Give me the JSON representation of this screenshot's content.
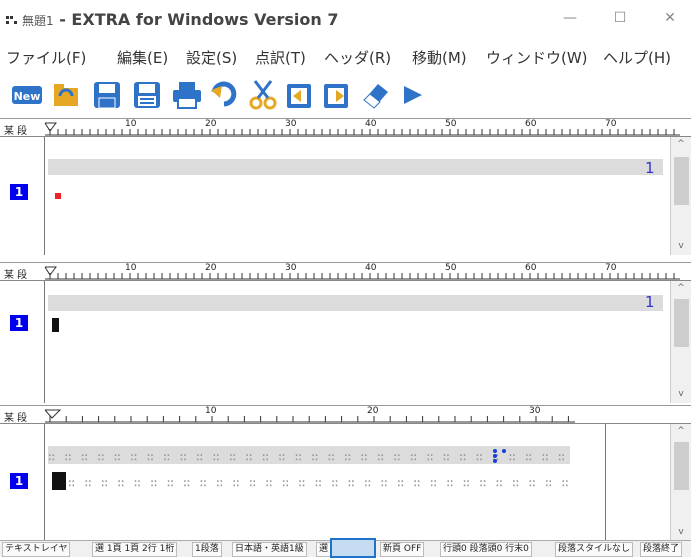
{
  "window": {
    "title_prefix": "無題1",
    "title_app": " - EXTRA for Windows Version 7",
    "minimize": "—",
    "maximize": "☐",
    "close": "✕"
  },
  "menu": [
    {
      "label": "ファイル(F)"
    },
    {
      "label": "編集(E)"
    },
    {
      "label": "設定(S)"
    },
    {
      "label": "点訳(T)"
    },
    {
      "label": "ヘッダ(R)"
    },
    {
      "label": "移動(M)"
    },
    {
      "label": "ウィンドウ(W)"
    },
    {
      "label": "ヘルプ(H)"
    }
  ],
  "toolbar": {
    "new_label": "New"
  },
  "ruler": {
    "label": "某 段",
    "ticks_top": [
      "10",
      "20",
      "30",
      "40",
      "50",
      "60",
      "70"
    ],
    "ticks_bottom": [
      "10",
      "20",
      "30"
    ]
  },
  "panes": [
    {
      "line_number": "1",
      "row_count": "1"
    },
    {
      "line_number": "1",
      "row_count": "1"
    },
    {
      "line_number": "1"
    }
  ],
  "braille": {
    "row1": "∷ ∷ ∷ ∷ ∷ ∷ ∷ ∷ ∷ ∷ ∷ ∷ ∷ ∷ ∷ ∷ ∷ ∷ ∷ ∷ ∷ ∷ ∷ ∷ ∷ ∷ ∷ ∷ ∷ ∷ ∷ ∷ ∷ ∷ ∷ ∷ ∷ ∷ ∷ ∷ ∷ ∷ ∷ ∷",
    "row2": "∷ ∷ ∷ ∷ ∷ ∷ ∷ ∷ ∷ ∷ ∷ ∷ ∷ ∷ ∷ ∷ ∷ ∷ ∷ ∷ ∷ ∷ ∷ ∷ ∷ ∷ ∷ ∷ ∷ ∷ ∷ ∷ ∷ ∷ ∷ ∷ ∷ ∷ ∷ ∷ ∷ ∷ ∷ ∷"
  },
  "status": [
    {
      "label": "テキストレイヤ"
    },
    {
      "label": "選 1頁 1頁 2行 1桁"
    },
    {
      "label": "1段落"
    },
    {
      "label": "日本語・英語1級"
    },
    {
      "label": "選"
    },
    {
      "label": "新頁 OFF"
    },
    {
      "label": "行頭0 段落頭0 行末0"
    },
    {
      "label": "段落スタイルなし"
    },
    {
      "label": "段落終了"
    }
  ],
  "colors": {
    "accent_blue": "#0000ee",
    "cursor_red": "#ee2222",
    "braille_blue": "#1a3fd6"
  }
}
